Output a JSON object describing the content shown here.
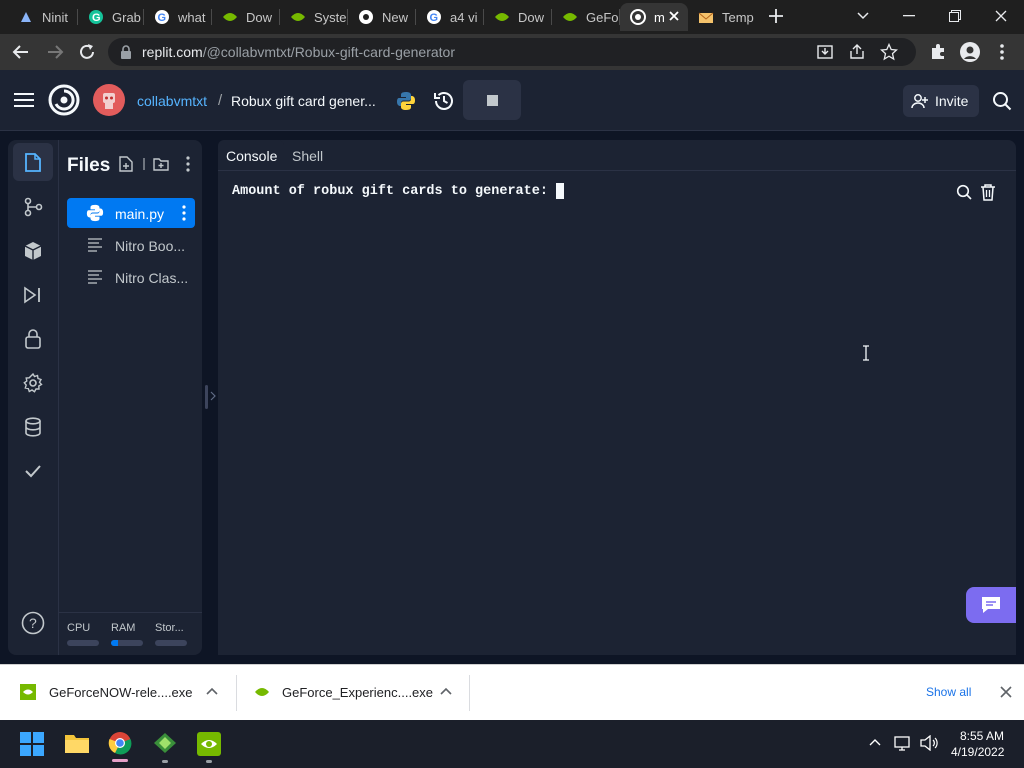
{
  "browser": {
    "tabs": [
      {
        "title": "Ninit",
        "icon": "ninite-icon",
        "active": false
      },
      {
        "title": "Grab",
        "icon": "grammarly-icon",
        "active": false
      },
      {
        "title": "what",
        "icon": "google-icon",
        "active": false
      },
      {
        "title": "Dow",
        "icon": "nvidia-icon",
        "active": false
      },
      {
        "title": "Syste",
        "icon": "nvidia-icon",
        "active": false
      },
      {
        "title": "New",
        "icon": "chrome-icon",
        "active": false
      },
      {
        "title": "a4 vi",
        "icon": "google-icon",
        "active": false
      },
      {
        "title": "Dow",
        "icon": "nvidia-icon",
        "active": false
      },
      {
        "title": "GeFo",
        "icon": "nvidia-icon",
        "active": false
      },
      {
        "title": "m",
        "icon": "replit-icon",
        "active": true
      },
      {
        "title": "Temp",
        "icon": "mail-icon",
        "active": false
      }
    ],
    "url_host": "replit.com",
    "url_path": "/@collabvmtxt/Robux-gift-card-generator"
  },
  "replit": {
    "user": "collabvmtxt",
    "separator": "/",
    "repl_name": "Robux gift card gener...",
    "invite_label": "Invite",
    "files_title": "Files",
    "files": [
      {
        "name": "main.py",
        "selected": true,
        "icon": "python-icon"
      },
      {
        "name": "Nitro Boo...",
        "selected": false,
        "icon": "text-file-icon"
      },
      {
        "name": "Nitro Clas...",
        "selected": false,
        "icon": "text-file-icon"
      }
    ],
    "resources": {
      "cpu_label": "CPU",
      "ram_label": "RAM",
      "storage_label": "Stor...",
      "cpu": 0.0,
      "ram": 0.22,
      "storage": 0.0
    },
    "console_tab": "Console",
    "shell_tab": "Shell",
    "console_output": "Amount of robux gift cards to generate: "
  },
  "downloads": {
    "items": [
      {
        "name": "GeForceNOW-rele....exe"
      },
      {
        "name": "GeForce_Experienc....exe"
      }
    ],
    "show_all": "Show all"
  },
  "taskbar": {
    "time": "8:55 AM",
    "date": "4/19/2022"
  },
  "colors": {
    "accent": "#0079f2",
    "selected_file": "#0079f2",
    "chat_button": "#7c6cf0",
    "nvidia": "#76b900",
    "avatar": "#e25c5c"
  }
}
